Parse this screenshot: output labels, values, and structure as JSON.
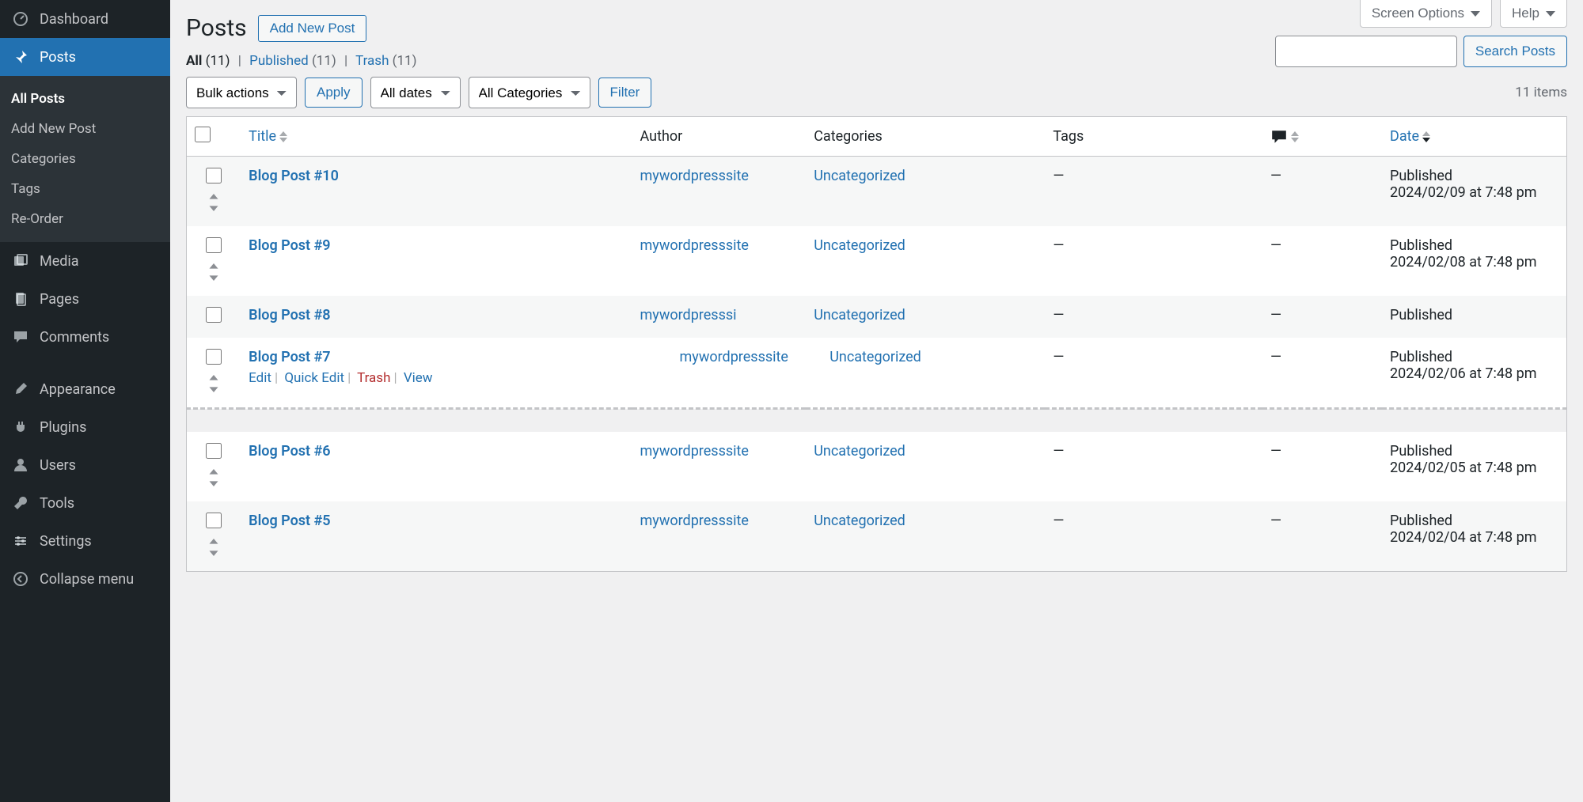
{
  "topTabs": {
    "screenOptions": "Screen Options",
    "help": "Help"
  },
  "sidebar": {
    "dashboard": "Dashboard",
    "posts": "Posts",
    "submenu": {
      "allPosts": "All Posts",
      "addNew": "Add New Post",
      "categories": "Categories",
      "tags": "Tags",
      "reorder": "Re-Order"
    },
    "media": "Media",
    "pages": "Pages",
    "comments": "Comments",
    "appearance": "Appearance",
    "plugins": "Plugins",
    "users": "Users",
    "tools": "Tools",
    "settings": "Settings",
    "collapse": "Collapse menu"
  },
  "page": {
    "title": "Posts",
    "addNewBtn": "Add New Post"
  },
  "subsubsub": {
    "all": "All",
    "allCount": "(11)",
    "published": "Published",
    "publishedCount": "(11)",
    "trash": "Trash",
    "trashCount": "(11)"
  },
  "filters": {
    "bulk": "Bulk actions",
    "apply": "Apply",
    "dates": "All dates",
    "cats": "All Categories",
    "filter": "Filter",
    "items": "11 items"
  },
  "search": {
    "button": "Search Posts"
  },
  "columns": {
    "title": "Title",
    "author": "Author",
    "categories": "Categories",
    "tags": "Tags",
    "date": "Date"
  },
  "rowActions": {
    "edit": "Edit",
    "quickEdit": "Quick Edit",
    "trash": "Trash",
    "view": "View"
  },
  "em": "—",
  "posts": [
    {
      "title": "Blog Post #10",
      "author": "mywordpresssite",
      "cat": "Uncategorized",
      "status": "Published",
      "date": "2024/02/09 at 7:48 pm",
      "hover": false,
      "compact": false
    },
    {
      "title": "Blog Post #9",
      "author": "mywordpresssite",
      "cat": "Uncategorized",
      "status": "Published",
      "date": "2024/02/08 at 7:48 pm",
      "hover": false,
      "compact": false
    },
    {
      "title": "Blog Post #8",
      "author": "mywordpresssi",
      "cat": "Uncategorized",
      "status": "Published",
      "date": "",
      "hover": false,
      "compact": true
    },
    {
      "title": "Blog Post #7",
      "author": "mywordpresssite",
      "cat": "Uncategorized",
      "status": "Published",
      "date": "2024/02/06 at 7:48 pm",
      "hover": true,
      "compact": false
    },
    {
      "title": "Blog Post #6",
      "author": "mywordpresssite",
      "cat": "Uncategorized",
      "status": "Published",
      "date": "2024/02/05 at 7:48 pm",
      "hover": false,
      "compact": false
    },
    {
      "title": "Blog Post #5",
      "author": "mywordpresssite",
      "cat": "Uncategorized",
      "status": "Published",
      "date": "2024/02/04 at 7:48 pm",
      "hover": false,
      "compact": false
    }
  ]
}
